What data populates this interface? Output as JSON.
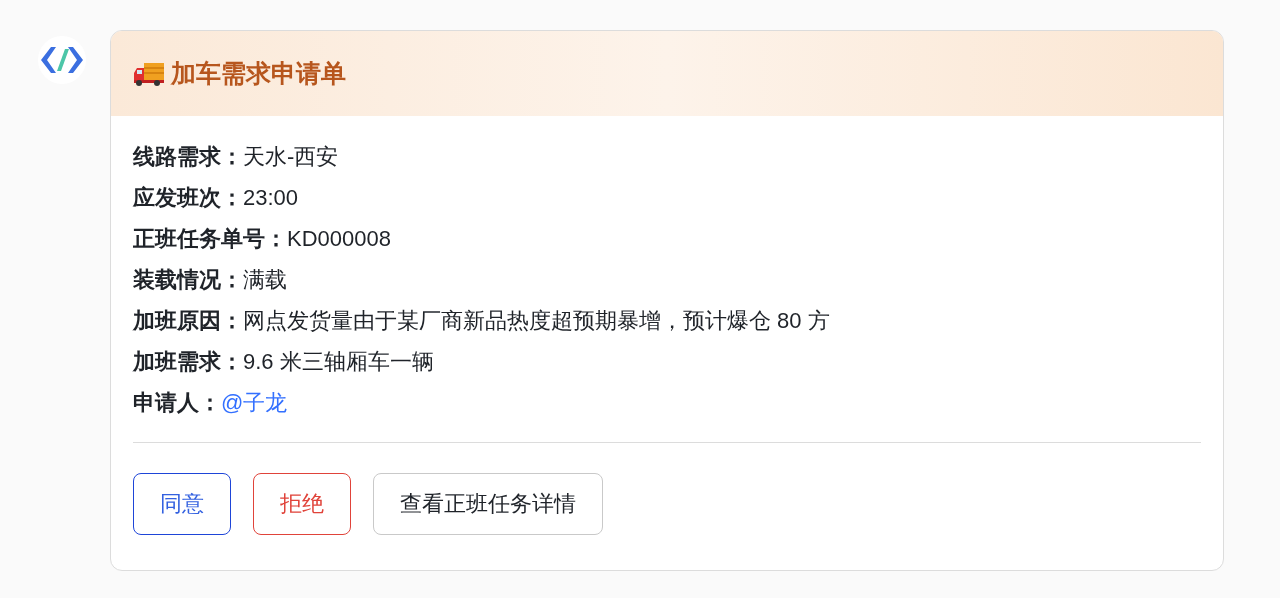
{
  "card": {
    "title": "加车需求申请单",
    "fields": [
      {
        "label": "线路需求：",
        "value": "天水-西安",
        "kind": "text"
      },
      {
        "label": "应发班次：",
        "value": "23:00",
        "kind": "text"
      },
      {
        "label": "正班任务单号：",
        "value": "KD000008",
        "kind": "text"
      },
      {
        "label": "装载情况：",
        "value": "满载",
        "kind": "text"
      },
      {
        "label": "加班原因：",
        "value": "网点发货量由于某厂商新品热度超预期暴增，预计爆仓 80 方",
        "kind": "text"
      },
      {
        "label": "加班需求：",
        "value": "9.6 米三轴厢车一辆",
        "kind": "text"
      },
      {
        "label": "申请人：",
        "value": "@子龙",
        "kind": "mention"
      }
    ],
    "buttons": [
      {
        "label": "同意",
        "kind": "primary"
      },
      {
        "label": "拒绝",
        "kind": "danger"
      },
      {
        "label": "查看正班任务详情",
        "kind": "default"
      }
    ]
  }
}
